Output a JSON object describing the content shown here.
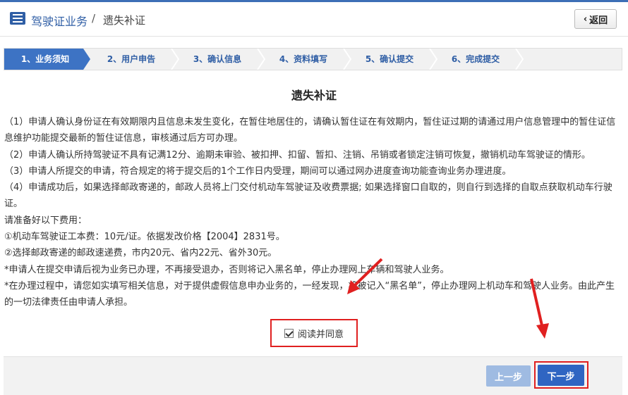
{
  "header": {
    "crumb_main": "驾驶证业务",
    "crumb_sep": "/",
    "crumb_sub": "遗失补证",
    "back_label": "返回"
  },
  "steps": [
    {
      "label": "1、业务须知",
      "active": true
    },
    {
      "label": "2、用户申告",
      "active": false
    },
    {
      "label": "3、确认信息",
      "active": false
    },
    {
      "label": "4、资料填写",
      "active": false
    },
    {
      "label": "5、确认提交",
      "active": false
    },
    {
      "label": "6、完成提交",
      "active": false
    }
  ],
  "title": "遗失补证",
  "content": {
    "p1": "（1）申请人确认身份证在有效期限内且信息未发生变化，在暂住地居住的，请确认暂住证在有效期内，暂住证过期的请通过用户信息管理中的暂住证信息维护功能提交最新的暂住证信息，审核通过后方可办理。",
    "p2": "（2）申请人确认所持驾驶证不具有记满12分、逾期未审验、被扣押、扣留、暂扣、注销、吊销或者锁定注销可恢复，撤销机动车驾驶证的情形。",
    "p3": "（3）申请人所提交的申请，符合规定的将于提交后的1个工作日内受理，期间可以通过网办进度查询功能查询业务办理进度。",
    "p4": "（4）申请成功后，如果选择邮政寄递的，邮政人员将上门交付机动车驾驶证及收费票据; 如果选择窗口自取的，则自行到选择的自取点获取机动车行驶证。",
    "p5": "请准备好以下费用：",
    "p6": "①机动车驾驶证工本费：10元/证。依据发改价格【2004】2831号。",
    "p7": "②选择邮政寄递的邮政速递费，市内20元、省内22元、省外30元。",
    "p8": "*申请人在提交申请后视为业务已办理，不再接受退办，否则将记入黑名单，停止办理网上车辆和驾驶人业务。",
    "p9": "*在办理过程中，请您如实填写相关信息，对于提供虚假信息申办业务的，一经发现，将被记入“黑名单”，停止办理网上机动车和驾驶人业务。由此产生的一切法律责任由申请人承担。"
  },
  "agree": {
    "label": "阅读并同意",
    "checked": true
  },
  "footer": {
    "prev_label": "上一步",
    "next_label": "下一步"
  },
  "colors": {
    "brand": "#2f5ea5",
    "step_active": "#3d73c4",
    "highlight": "#e02020",
    "next_button": "#2f65c2",
    "prev_button": "#9fbbe2"
  },
  "icons": {
    "header": "list-icon",
    "back": "chevron-left-icon",
    "check": "check-icon"
  }
}
